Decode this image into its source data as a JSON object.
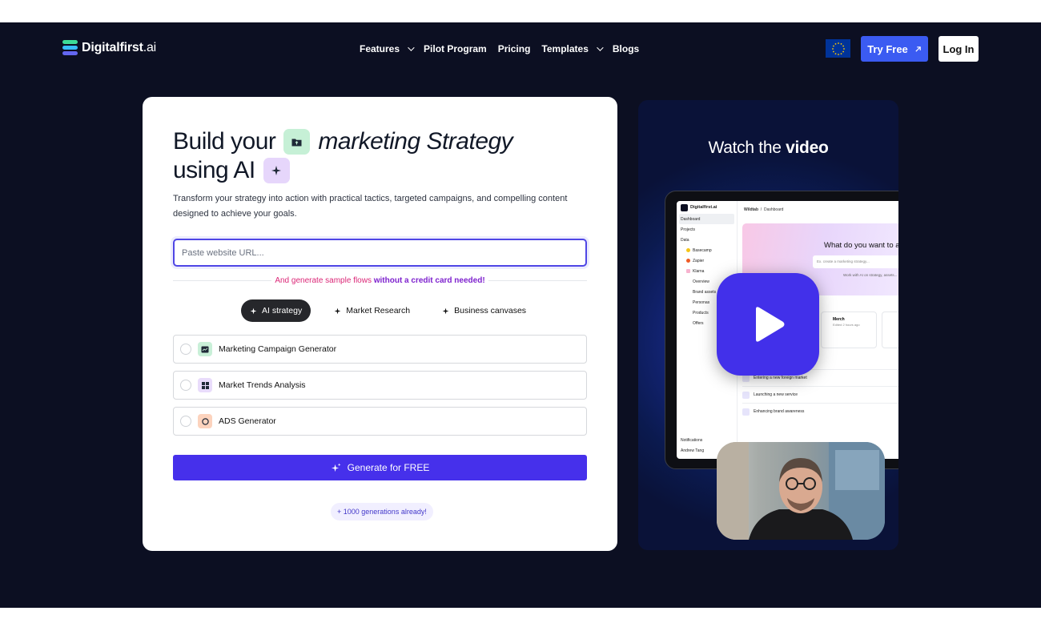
{
  "brand": {
    "name_bold": "Digitalfirst",
    "name_suffix": ".ai",
    "colors": {
      "page_bg": "#0c0f22",
      "accent": "#4630eb",
      "try_button": "#3b5bf2"
    }
  },
  "nav": {
    "items": [
      {
        "label": "Features",
        "dropdown": true
      },
      {
        "label": "Pilot Program",
        "dropdown": false
      },
      {
        "label": "Pricing",
        "dropdown": false
      },
      {
        "label": "Templates",
        "dropdown": true
      },
      {
        "label": "Blogs",
        "dropdown": false
      }
    ],
    "try_free": "Try Free",
    "login": "Log In"
  },
  "hero": {
    "title_part1": "Build your",
    "title_part2": "marketing Strategy",
    "title_part3": "using AI",
    "subtitle": "Transform your strategy into action with practical tactics, targeted campaigns, and compelling content designed to achieve your goals.",
    "url_placeholder": "Paste website URL...",
    "credit_note_a": "And generate sample flows ",
    "credit_note_b": "without a credit card needed!",
    "tabs": [
      {
        "label": "AI strategy",
        "active": true
      },
      {
        "label": "Market Research",
        "active": false
      },
      {
        "label": "Business canvases",
        "active": false
      }
    ],
    "options": [
      {
        "label": "Marketing Campaign Generator",
        "icon": "chart-icon",
        "color": "#c9f0d8"
      },
      {
        "label": "Market Trends Analysis",
        "icon": "grid-icon",
        "color": "#e9dcfb"
      },
      {
        "label": "ADS Generator",
        "icon": "target-icon",
        "color": "#fcd3bd"
      }
    ],
    "generate_button": "Generate for FREE",
    "generations_pill": "+ 1000 generations already!"
  },
  "video": {
    "title_light": "Watch the ",
    "title_bold": "video",
    "app": {
      "logo": "Digitalfirst.ai",
      "crumb_a": "Wildtab",
      "crumb_b": "Dashboard",
      "sidebar": [
        "Dashboard",
        "Projects",
        "Data",
        "Basecamp",
        "Zapier",
        "Klarna",
        "Overview",
        "Brand assets",
        "Personas",
        "Products",
        "Offers"
      ],
      "sidebar_bottom": [
        "Notifications",
        "Andrew Tang"
      ],
      "question": "What do you want to a",
      "input_placeholder": "Ex. create a marketing strategy...",
      "helper": "Work with AI on strategy, assets...",
      "card_name": "Merch",
      "card_meta": "Edited 2 hours ago",
      "tasks": [
        "Entering a new foreign market",
        "Launching a new service",
        "Enhancing brand awareness"
      ]
    }
  }
}
